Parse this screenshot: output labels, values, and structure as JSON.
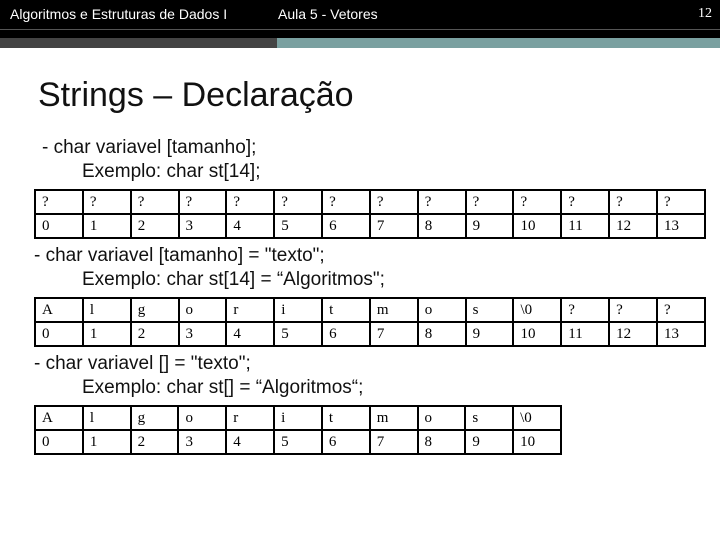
{
  "header": {
    "course": "Algoritmos e Estruturas de Dados I",
    "lecture": "Aula 5 -  Vetores",
    "page": "12"
  },
  "title": "Strings – Declaração",
  "block1": {
    "decl": "- char variavel [tamanho];",
    "example": "Exemplo: char st[14];",
    "row_vals": [
      "?",
      "?",
      "?",
      "?",
      "?",
      "?",
      "?",
      "?",
      "?",
      "?",
      "?",
      "?",
      "?",
      "?"
    ],
    "row_idx": [
      "0",
      "1",
      "2",
      "3",
      "4",
      "5",
      "6",
      "7",
      "8",
      "9",
      "10",
      "11",
      "12",
      "13"
    ]
  },
  "block2": {
    "decl": "- char variavel [tamanho] = \"texto\";",
    "example": "Exemplo:  char st[14] = “Algoritmos\";",
    "row_vals": [
      "A",
      "l",
      "g",
      "o",
      "r",
      "i",
      "t",
      "m",
      "o",
      "s",
      "\\0",
      "?",
      "?",
      "?"
    ],
    "row_idx": [
      "0",
      "1",
      "2",
      "3",
      "4",
      "5",
      "6",
      "7",
      "8",
      "9",
      "10",
      "11",
      "12",
      "13"
    ]
  },
  "block3": {
    "decl": "- char variavel [] = \"texto\";",
    "example": "Exemplo: char st[] = “Algoritmos“;",
    "row_vals": [
      "A",
      "l",
      "g",
      "o",
      "r",
      "i",
      "t",
      "m",
      "o",
      "s",
      "\\0"
    ],
    "row_idx": [
      "0",
      "1",
      "2",
      "3",
      "4",
      "5",
      "6",
      "7",
      "8",
      "9",
      "10"
    ]
  }
}
